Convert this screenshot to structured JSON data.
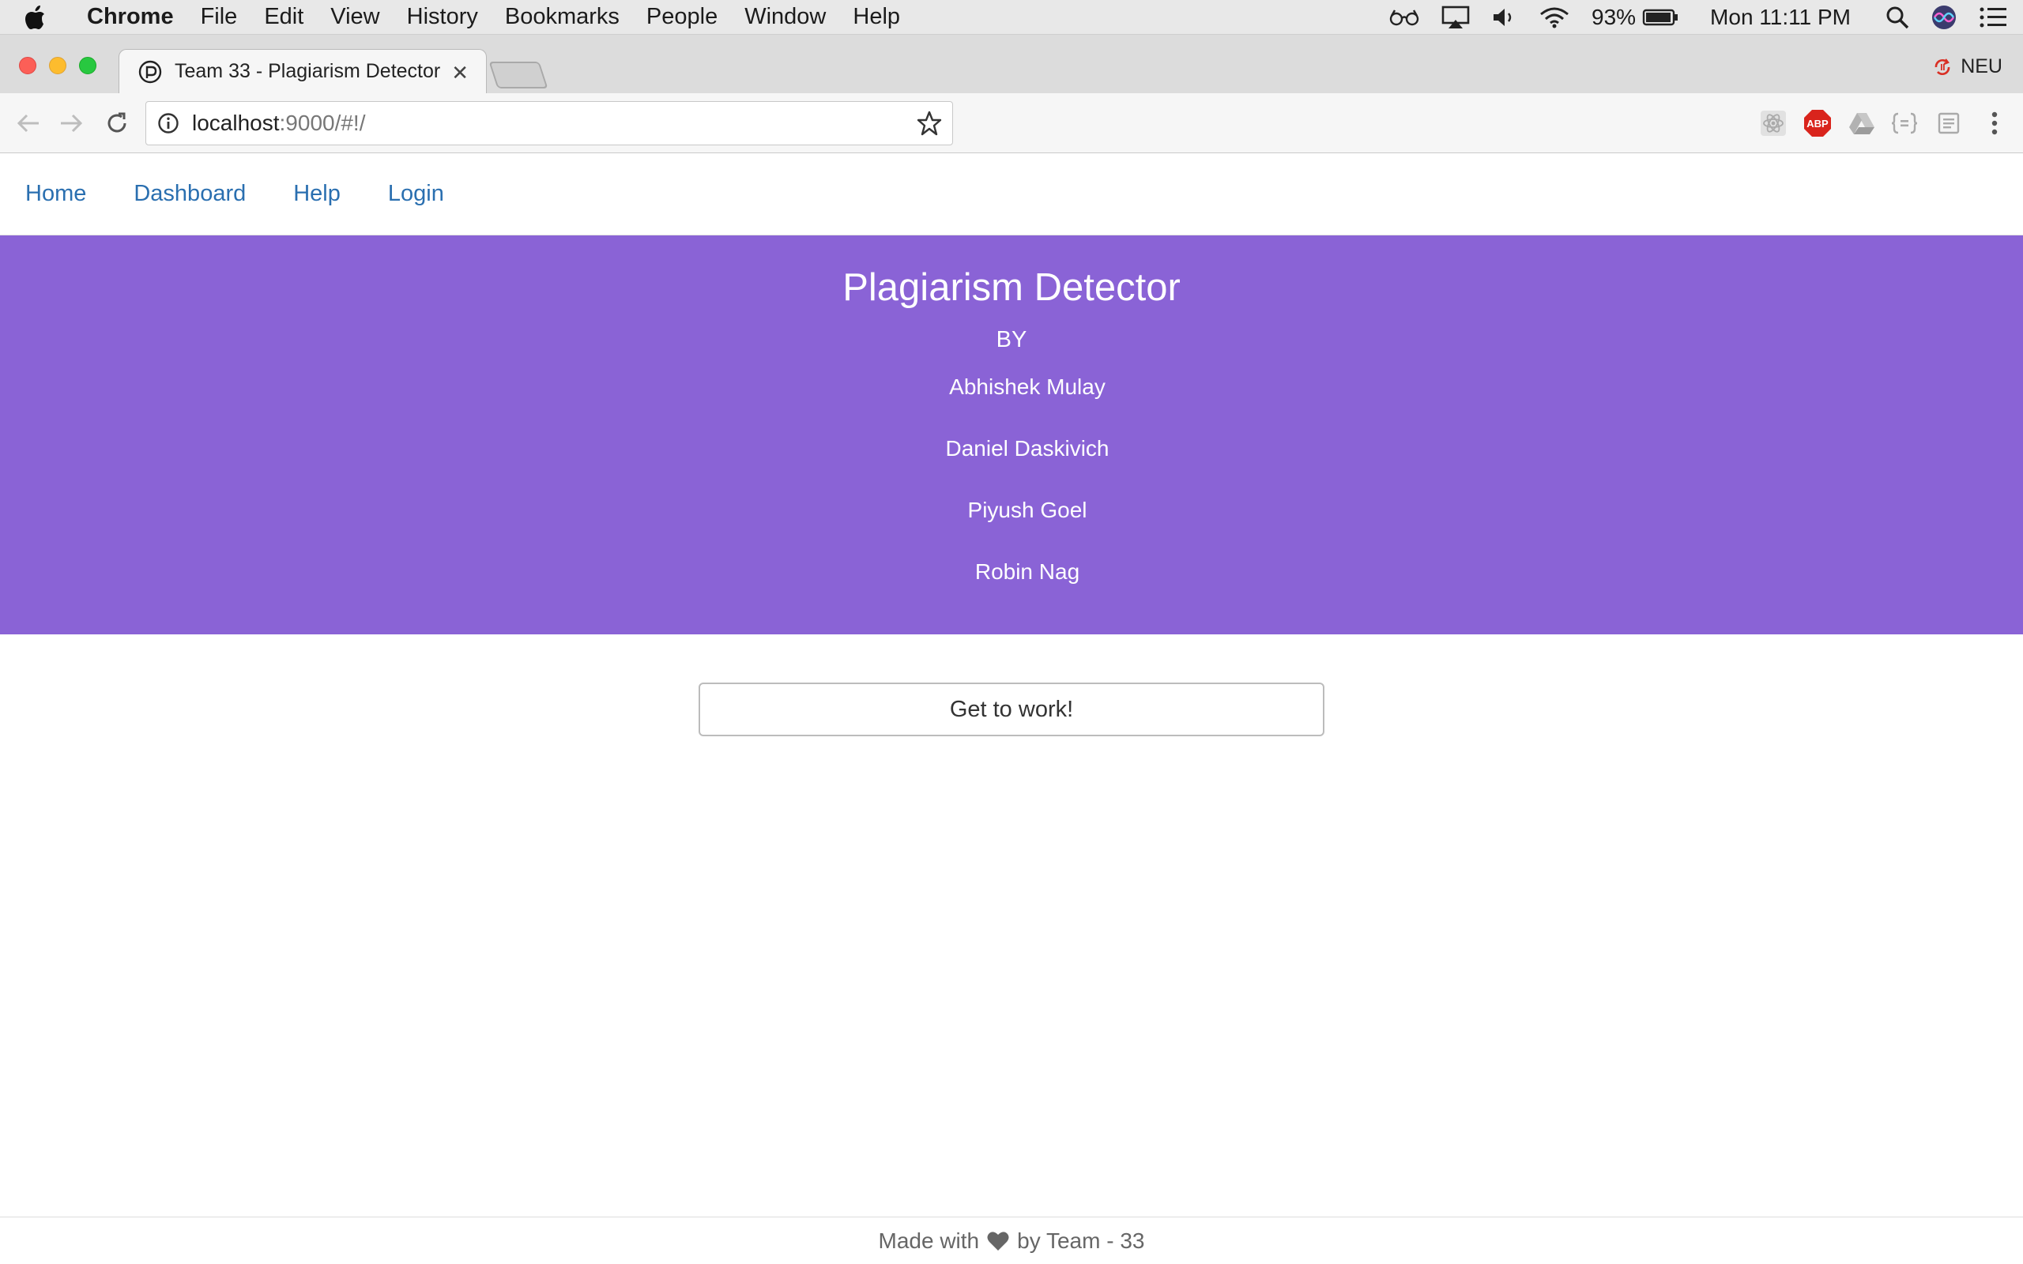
{
  "menubar": {
    "app": "Chrome",
    "items": [
      "File",
      "Edit",
      "View",
      "History",
      "Bookmarks",
      "People",
      "Window",
      "Help"
    ],
    "battery": "93%",
    "clock": "Mon 11:11 PM"
  },
  "browser": {
    "tab_title": "Team 33 - Plagiarism Detector",
    "profile": "NEU",
    "url_host": "localhost",
    "url_rest": ":9000/#!/",
    "adblock_label": "ABP"
  },
  "nav": {
    "items": [
      "Home",
      "Dashboard",
      "Help",
      "Login"
    ]
  },
  "hero": {
    "title": "Plagiarism Detector",
    "by": "BY",
    "members": [
      "Abhishek Mulay",
      "Daniel Daskivich",
      "Piyush Goel",
      "Robin Nag"
    ]
  },
  "cta": {
    "label": "Get to work!"
  },
  "footer": {
    "prefix": "Made with",
    "suffix": "by Team - 33"
  },
  "colors": {
    "hero_bg": "#8a63d6",
    "link": "#2a6fb0"
  }
}
